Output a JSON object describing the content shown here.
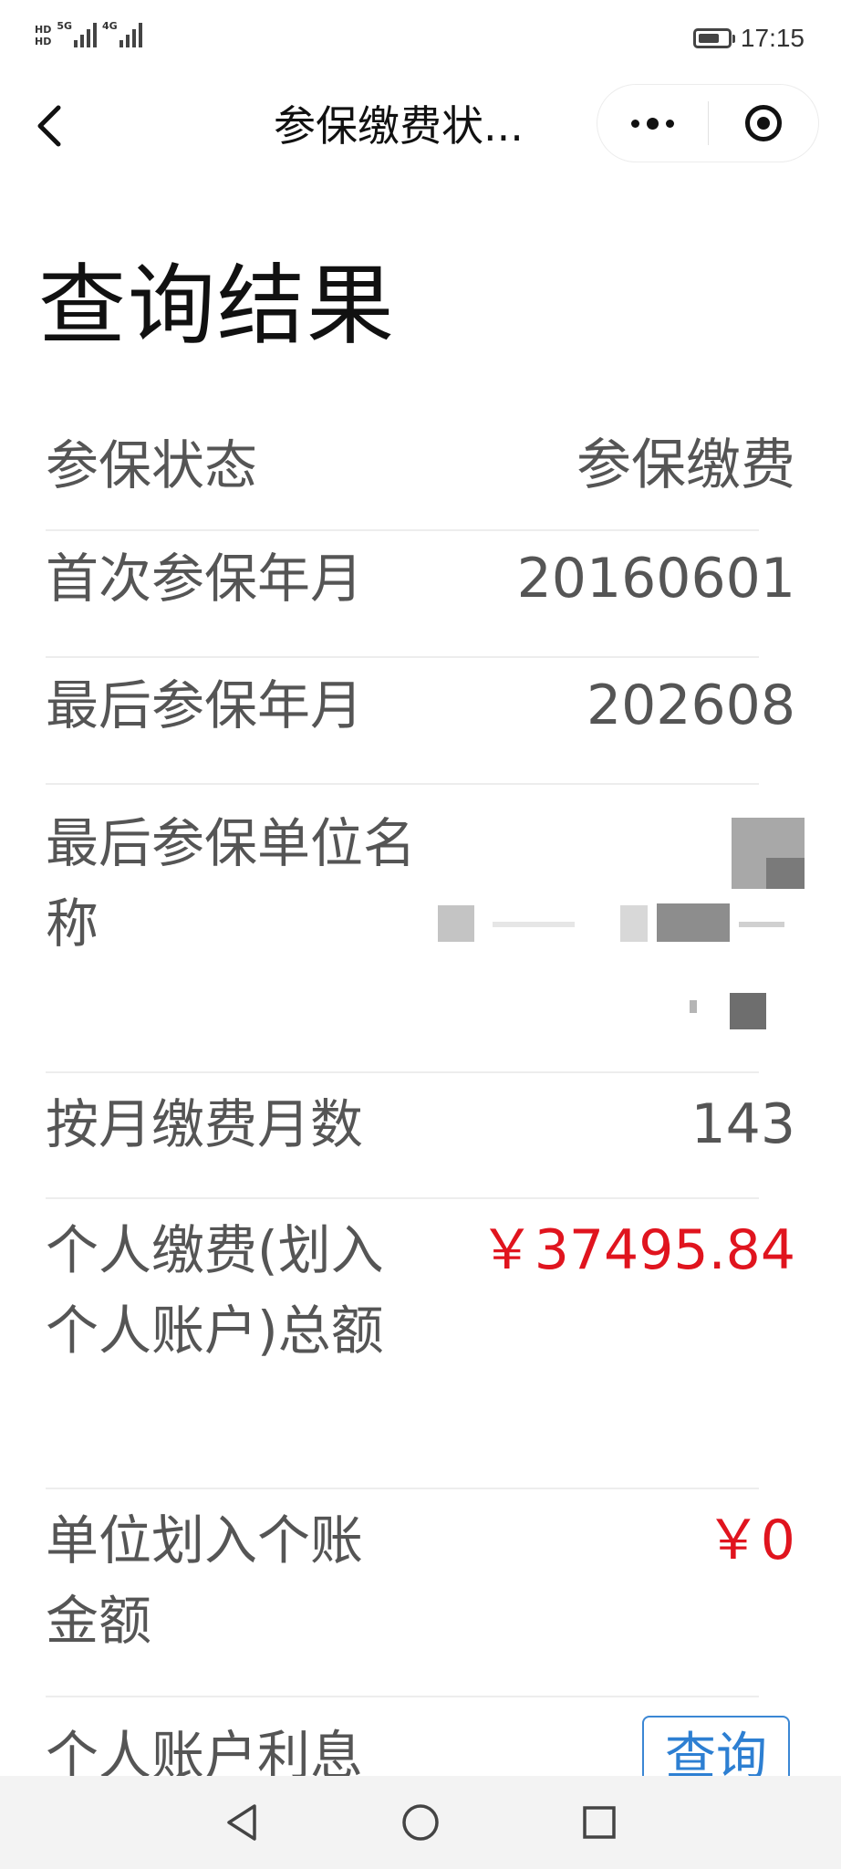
{
  "status_bar": {
    "hd_labels": [
      "HD",
      "HD"
    ],
    "network_5g": "5G",
    "network_4g": "4G",
    "time": "17:15"
  },
  "nav": {
    "title": "参保缴费状...",
    "back_icon": "chevron-left-icon",
    "more_icon": "more-dots-icon",
    "close_icon": "target-circle-icon"
  },
  "page": {
    "title": "查询结果"
  },
  "rows": [
    {
      "label": "参保状态",
      "value": "参保缴费"
    },
    {
      "label": "首次参保年月",
      "value": "20160601"
    },
    {
      "label": "最后参保年月",
      "value": "202608"
    },
    {
      "label": "最后参保单位名称",
      "value": ""
    },
    {
      "label": "按月缴费月数",
      "value": "143"
    },
    {
      "label": "个人缴费(划入个人账户)总额",
      "value": "￥37495.84"
    },
    {
      "label": "单位划入个账金额",
      "value": "￥0"
    },
    {
      "label": "个人账户利息",
      "value": ""
    }
  ],
  "query_button": {
    "label": "查询"
  },
  "colors": {
    "amount_red": "#e0141e",
    "link_blue": "#2d7fd2",
    "label_gray": "#555555"
  },
  "system_nav": {
    "back_icon": "triangle-back-icon",
    "home_icon": "circle-home-icon",
    "recents_icon": "square-recents-icon"
  }
}
